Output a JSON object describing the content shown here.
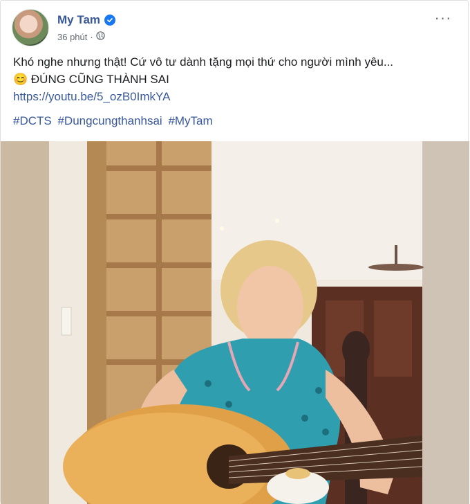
{
  "post": {
    "author": "My Tam",
    "time": "36 phút",
    "separator": "·",
    "text_line1": "Khó nghe nhưng thật! Cứ vô tư dành tặng mọi thứ cho người mình yêu...",
    "emoji": "😊",
    "text_line2": "ĐÚNG CŨNG THÀNH SAI",
    "link": "https://youtu.be/5_ozB0ImkYA",
    "hashtags": [
      "#DCTS",
      "#Dungcungthanhsai",
      "#MyTam"
    ],
    "more_label": "···"
  },
  "colors": {
    "link": "#385898",
    "verified": "#1877f2",
    "meta": "#606770"
  },
  "icons": {
    "verified": "verified-badge-icon",
    "audience": "globe-icon",
    "more": "more-options-icon"
  }
}
